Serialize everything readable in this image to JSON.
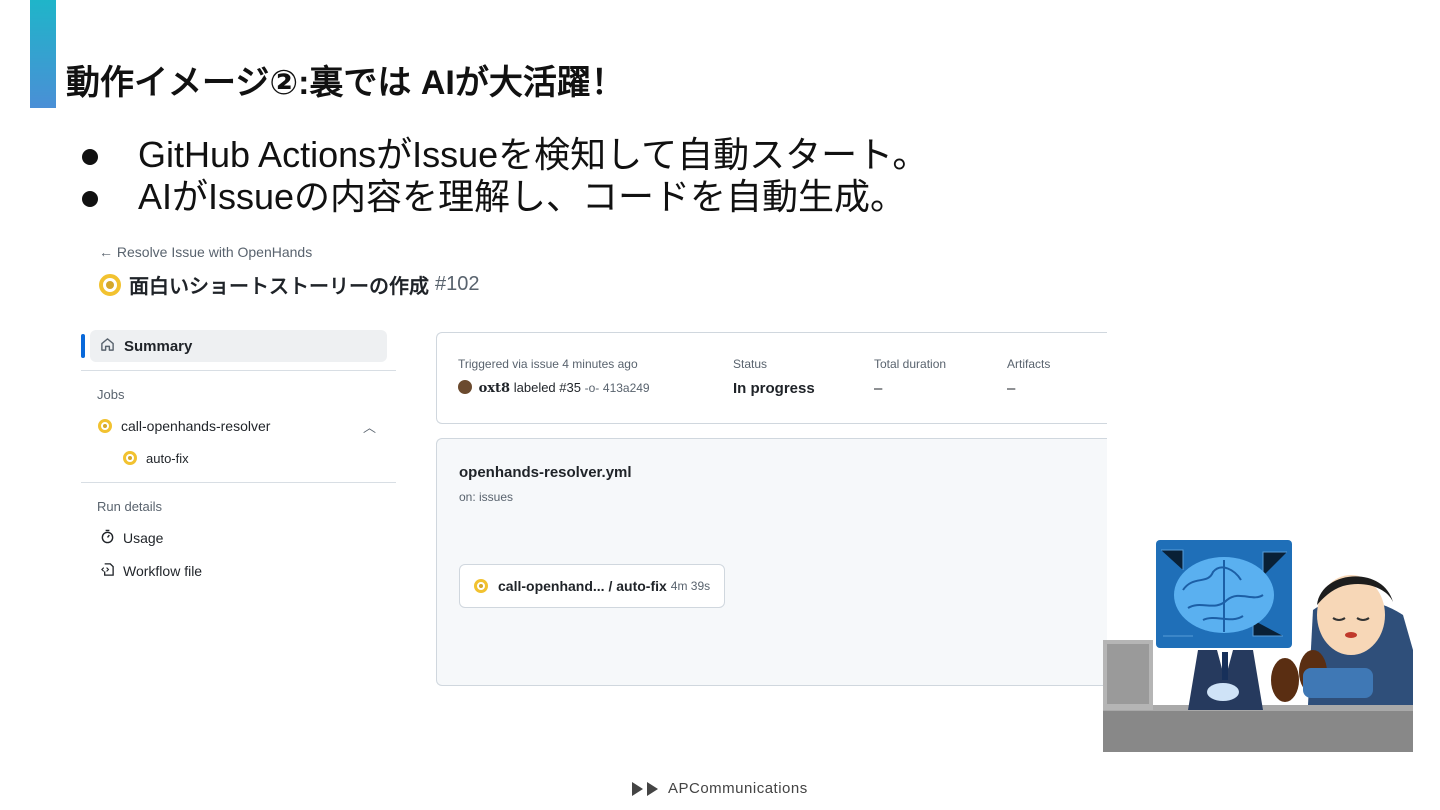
{
  "slide": {
    "title": "動作イメージ②:裏では AIが大活躍！",
    "bullets": [
      "GitHub ActionsがIssueを検知して自動スタート。",
      "AIがIssueの内容を理解し、コードを自動生成。"
    ],
    "footer": "APCommunications"
  },
  "run": {
    "back_label": "Resolve Issue with OpenHands",
    "title": "面白いショートストーリーの作成",
    "number": "#102",
    "status_color": "#f2c230"
  },
  "sidebar": {
    "summary_label": "Summary",
    "jobs_section": "Jobs",
    "job": "call-openhands-resolver",
    "subjob": "auto-fix",
    "run_details_section": "Run details",
    "details": [
      {
        "label": "Usage",
        "icon": "stopwatch-icon"
      },
      {
        "label": "Workflow file",
        "icon": "workflow-file-icon"
      }
    ]
  },
  "summary": {
    "triggered_label": "Triggered via issue 4 minutes ago",
    "user": "oxt8",
    "action_text": "labeled #35",
    "commit": "413a249",
    "status_label": "Status",
    "status_value": "In progress",
    "duration_label": "Total duration",
    "duration_value": "–",
    "artifacts_label": "Artifacts",
    "artifacts_value": "–"
  },
  "workflow": {
    "file": "openhands-resolver.yml",
    "trigger": "on: issues",
    "job_label": "call-openhand... / auto-fix",
    "job_duration": "4m 39s"
  }
}
